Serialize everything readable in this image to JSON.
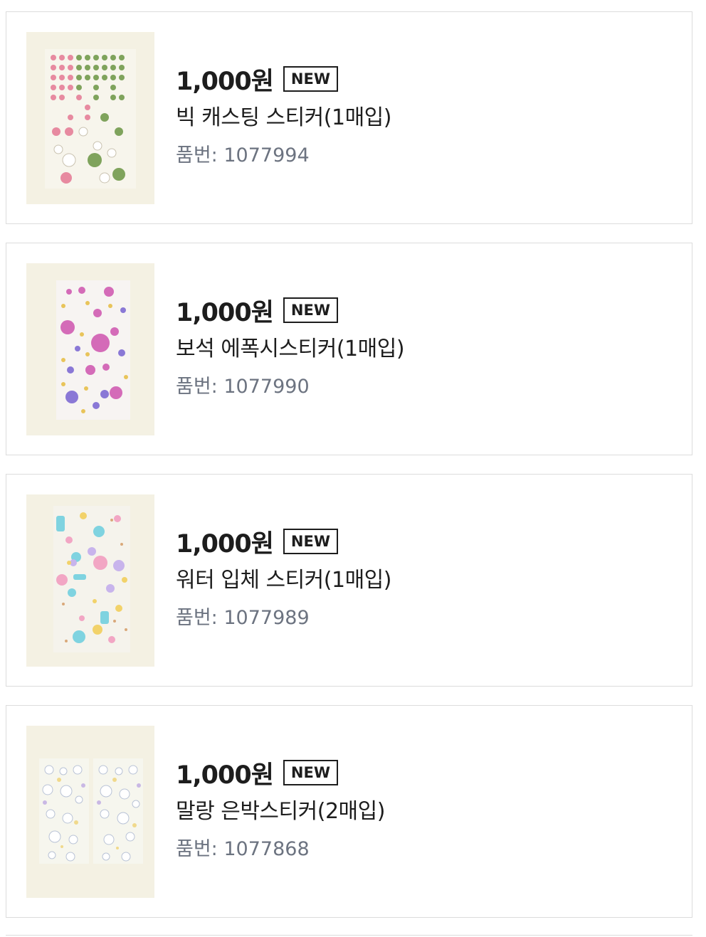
{
  "products": [
    {
      "price": "1,000원",
      "badge": "NEW",
      "name": "빅 캐스팅 스티커(1매입)",
      "code_label": "품번:",
      "code": "1077994",
      "image": "sticker-sheet-pink-green"
    },
    {
      "price": "1,000원",
      "badge": "NEW",
      "name": "보석 에폭시스티커(1매입)",
      "code_label": "품번:",
      "code": "1077990",
      "image": "sticker-sheet-jewel-purple"
    },
    {
      "price": "1,000원",
      "badge": "NEW",
      "name": "워터 입체 스티커(1매입)",
      "code_label": "품번:",
      "code": "1077989",
      "image": "sticker-sheet-water-pastel"
    },
    {
      "price": "1,000원",
      "badge": "NEW",
      "name": "말랑 은박스티커(2매입)",
      "code_label": "품번:",
      "code": "1077868",
      "image": "sticker-sheet-silver-foil"
    }
  ],
  "colors": {
    "text": "#1d1d1d",
    "muted": "#6c7380",
    "border": "#dcdcdc",
    "thumb_bg": "#f4f1e3"
  }
}
